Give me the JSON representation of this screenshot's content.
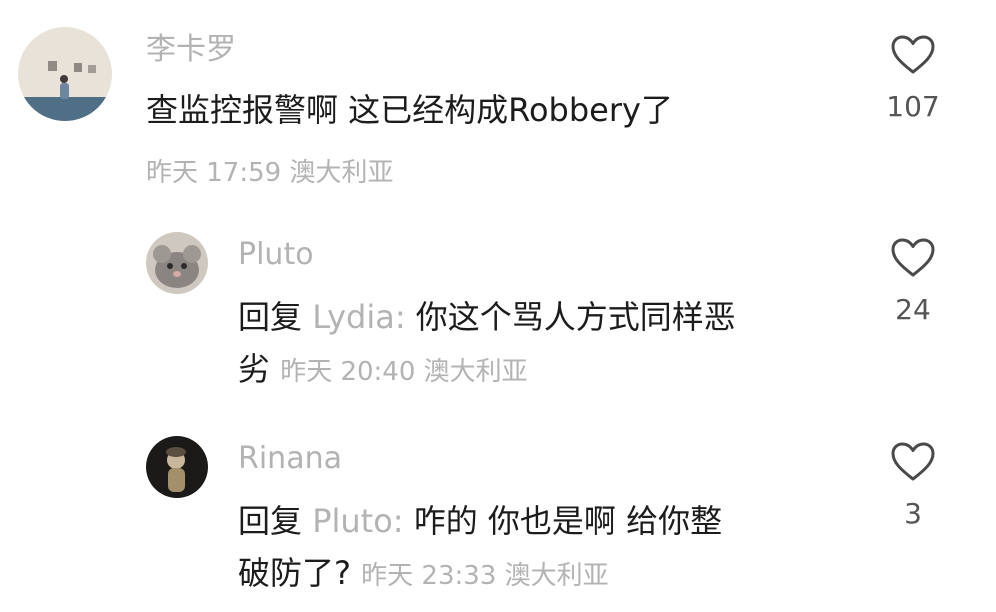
{
  "comments": [
    {
      "username": "李卡罗",
      "text": "查监控报警啊 这已经构成Robbery了",
      "time": "昨天 17:59",
      "location": "澳大利亚",
      "likes": "107"
    },
    {
      "username": "Pluto",
      "reply_prefix": "回复",
      "reply_to": "Lydia:",
      "text_line1": "你这个骂人方式同样恶",
      "text_line2": "劣",
      "time": "昨天 20:40",
      "location": "澳大利亚",
      "likes": "24"
    },
    {
      "username": "Rinana",
      "reply_prefix": "回复",
      "reply_to": "Pluto:",
      "text_line1": "咋的 你也是啊 给你整",
      "text_line2": "破防了?",
      "time": "昨天 23:33",
      "location": "澳大利亚",
      "likes": "3"
    }
  ],
  "icons": {
    "like": "heart-outline-icon"
  }
}
